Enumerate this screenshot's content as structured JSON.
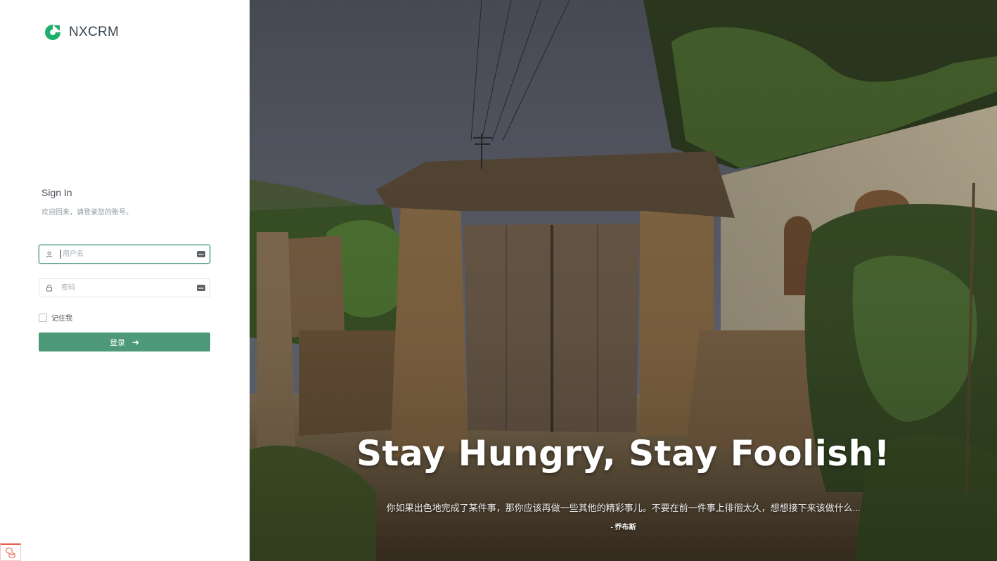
{
  "brand": {
    "name": "NXCRM",
    "color": "#1eb06a"
  },
  "signin": {
    "title": "Sign In",
    "subtitle": "欢迎回来，请登录您的账号。"
  },
  "form": {
    "username_placeholder": "用户名",
    "password_placeholder": "密码",
    "remember_label": "记住我",
    "remember_checked": false,
    "submit_label": "登录",
    "submit_color": "#4e9a78"
  },
  "hero": {
    "headline": "Stay Hungry, Stay Foolish!",
    "quote": "你如果出色地完成了某件事，那你应该再做一些其他的精彩事儿。不要在前一件事上徘徊太久，想想接下来该做什么...",
    "author": "- 乔布斯"
  },
  "icons": {
    "brand_logo": "nxcrm-logo-icon",
    "username": "user-icon",
    "password": "lock-icon",
    "keypad": "keypad-icon",
    "submit_arrow": "arrow-right-icon",
    "corner": "laravel-icon"
  }
}
